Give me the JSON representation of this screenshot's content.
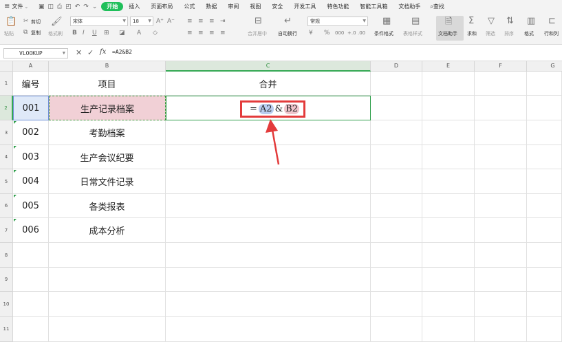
{
  "menubar": {
    "file_label": "文件",
    "tabs": [
      "开始",
      "插入",
      "页面布局",
      "公式",
      "数据",
      "审阅",
      "视图",
      "安全",
      "开发工具",
      "特色功能",
      "智能工具箱",
      "文档助手"
    ],
    "active_tab": "开始",
    "search_label": "查找"
  },
  "ribbon": {
    "paste": "粘贴",
    "cut": "剪切",
    "copy": "复制",
    "format_painter": "格式刷",
    "font_name": "宋体",
    "font_size": "18",
    "merge_center": "合并居中",
    "wrap_text": "自动换行",
    "number_format": "常规",
    "conditional_format": "条件格式",
    "table_style": "表格样式",
    "doc_helper": "文档助手",
    "sum": "求和",
    "filter": "筛选",
    "sort": "排序",
    "format": "格式",
    "row_col": "行和列"
  },
  "formula_bar": {
    "name_box": "VLOOKUP",
    "formula": "=A2&B2"
  },
  "sheet": {
    "columns": [
      "A",
      "B",
      "C",
      "D",
      "E",
      "F",
      "G"
    ],
    "rows": [
      "1",
      "2",
      "3",
      "4",
      "5",
      "6",
      "7",
      "8",
      "9",
      "10",
      "11"
    ],
    "header_row": {
      "a": "编号",
      "b": "项目",
      "c": "合并"
    },
    "data": [
      {
        "a": "001",
        "b": "生产记录档案"
      },
      {
        "a": "002",
        "b": "考勤档案"
      },
      {
        "a": "003",
        "b": "生产会议纪要"
      },
      {
        "a": "004",
        "b": "日常文件记录"
      },
      {
        "a": "005",
        "b": "各类报表"
      },
      {
        "a": "006",
        "b": "成本分析"
      }
    ],
    "editing_formula": {
      "eq": "=",
      "ref_a": "A2",
      "amp": "&",
      "ref_b": "B2"
    }
  },
  "colors": {
    "active_tab": "#1fbf5a",
    "highlight_box": "#e33b3b",
    "selection": "#2e9e4a"
  }
}
